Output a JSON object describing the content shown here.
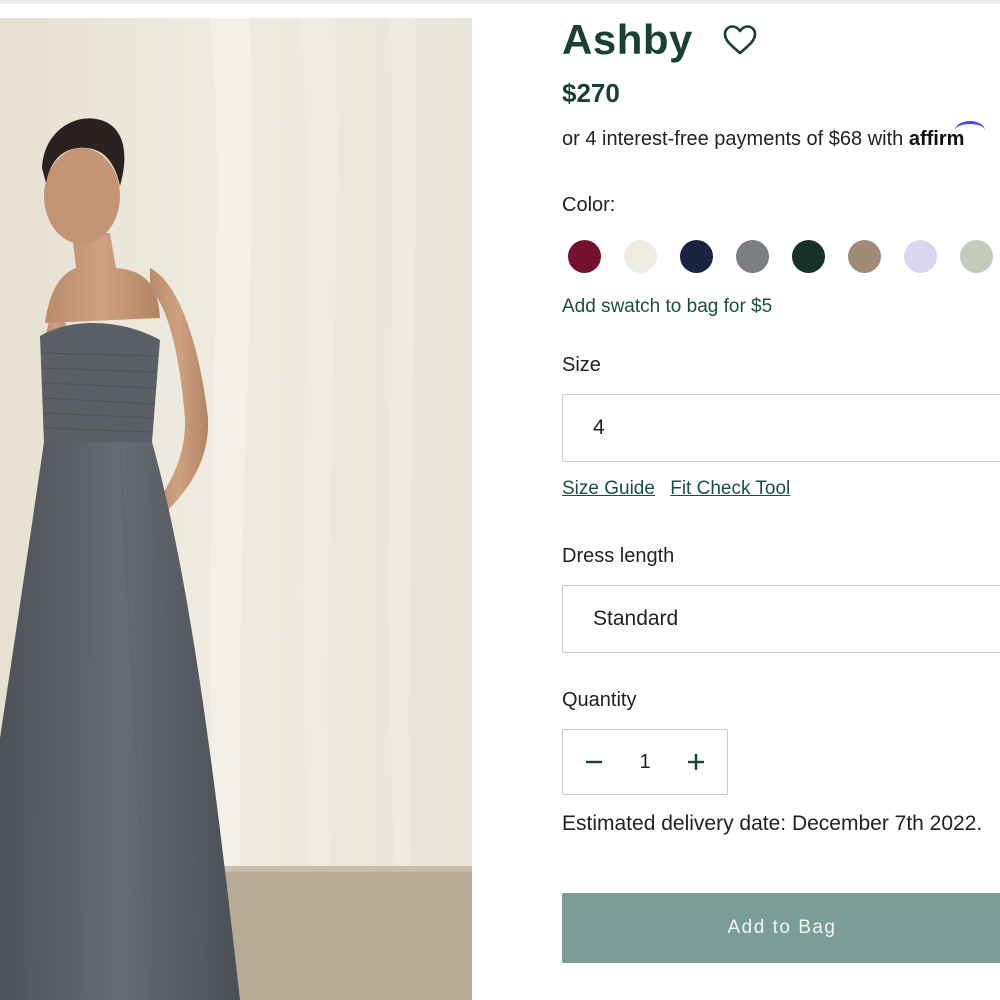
{
  "product": {
    "title": "Ashby",
    "price": "$270",
    "installments_text": "or 4 interest-free payments of $68 with",
    "affirm_logo_text": "affirm",
    "wishlist_icon": "heart-outline-icon"
  },
  "color": {
    "label": "Color:",
    "swatches": [
      {
        "name": "burgundy",
        "hex": "#74122e"
      },
      {
        "name": "ivory",
        "hex": "#efece4"
      },
      {
        "name": "navy",
        "hex": "#1a2340"
      },
      {
        "name": "slate-gray",
        "hex": "#7b7e82"
      },
      {
        "name": "dark-green",
        "hex": "#173228"
      },
      {
        "name": "taupe",
        "hex": "#a08a78"
      },
      {
        "name": "lavender",
        "hex": "#d9d6f1"
      },
      {
        "name": "sage",
        "hex": "#c3cbbb"
      }
    ],
    "swatch_link": "Add swatch to bag for $5"
  },
  "size": {
    "label": "Size",
    "value": "4",
    "guide_link": "Size Guide",
    "fit_check_link": "Fit Check Tool"
  },
  "dress_length": {
    "label": "Dress length",
    "value": "Standard"
  },
  "quantity": {
    "label": "Quantity",
    "value": "1",
    "minus_icon": "minus-icon",
    "plus_icon": "plus-icon"
  },
  "delivery_text": "Estimated delivery date: December 7th 2022.",
  "cta": {
    "add_to_bag": "Add to Bag"
  },
  "colors": {
    "brand_green": "#1a3f34",
    "link_green": "#1a5040",
    "button_bg": "#7b9d96",
    "border": "#c9c9c9"
  }
}
